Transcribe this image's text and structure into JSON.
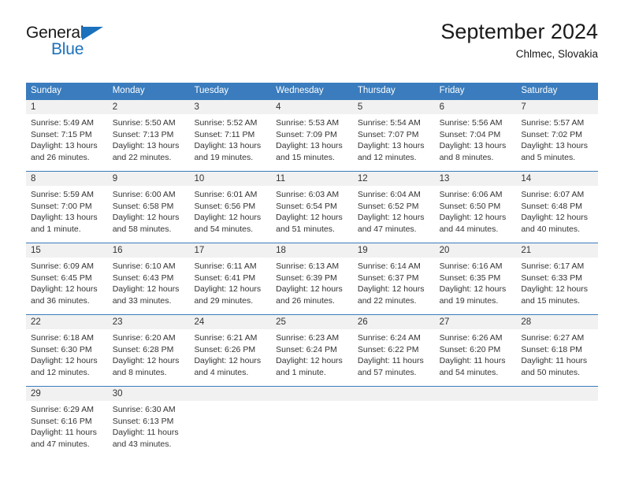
{
  "brand": {
    "name_top": "General",
    "name_bottom": "Blue",
    "triangle_color": "#1c71bd"
  },
  "header": {
    "title": "September 2024",
    "subtitle": "Chlmec, Slovakia"
  },
  "theme": {
    "header_blue": "#3a7cbd",
    "day_band_gray": "#f1f1f1",
    "text": "#333333"
  },
  "calendar": {
    "day_headers": [
      "Sunday",
      "Monday",
      "Tuesday",
      "Wednesday",
      "Thursday",
      "Friday",
      "Saturday"
    ],
    "weeks": [
      [
        {
          "date": "1",
          "sunrise": "Sunrise: 5:49 AM",
          "sunset": "Sunset: 7:15 PM",
          "daylight_line1": "Daylight: 13 hours",
          "daylight_line2": "and 26 minutes."
        },
        {
          "date": "2",
          "sunrise": "Sunrise: 5:50 AM",
          "sunset": "Sunset: 7:13 PM",
          "daylight_line1": "Daylight: 13 hours",
          "daylight_line2": "and 22 minutes."
        },
        {
          "date": "3",
          "sunrise": "Sunrise: 5:52 AM",
          "sunset": "Sunset: 7:11 PM",
          "daylight_line1": "Daylight: 13 hours",
          "daylight_line2": "and 19 minutes."
        },
        {
          "date": "4",
          "sunrise": "Sunrise: 5:53 AM",
          "sunset": "Sunset: 7:09 PM",
          "daylight_line1": "Daylight: 13 hours",
          "daylight_line2": "and 15 minutes."
        },
        {
          "date": "5",
          "sunrise": "Sunrise: 5:54 AM",
          "sunset": "Sunset: 7:07 PM",
          "daylight_line1": "Daylight: 13 hours",
          "daylight_line2": "and 12 minutes."
        },
        {
          "date": "6",
          "sunrise": "Sunrise: 5:56 AM",
          "sunset": "Sunset: 7:04 PM",
          "daylight_line1": "Daylight: 13 hours",
          "daylight_line2": "and 8 minutes."
        },
        {
          "date": "7",
          "sunrise": "Sunrise: 5:57 AM",
          "sunset": "Sunset: 7:02 PM",
          "daylight_line1": "Daylight: 13 hours",
          "daylight_line2": "and 5 minutes."
        }
      ],
      [
        {
          "date": "8",
          "sunrise": "Sunrise: 5:59 AM",
          "sunset": "Sunset: 7:00 PM",
          "daylight_line1": "Daylight: 13 hours",
          "daylight_line2": "and 1 minute."
        },
        {
          "date": "9",
          "sunrise": "Sunrise: 6:00 AM",
          "sunset": "Sunset: 6:58 PM",
          "daylight_line1": "Daylight: 12 hours",
          "daylight_line2": "and 58 minutes."
        },
        {
          "date": "10",
          "sunrise": "Sunrise: 6:01 AM",
          "sunset": "Sunset: 6:56 PM",
          "daylight_line1": "Daylight: 12 hours",
          "daylight_line2": "and 54 minutes."
        },
        {
          "date": "11",
          "sunrise": "Sunrise: 6:03 AM",
          "sunset": "Sunset: 6:54 PM",
          "daylight_line1": "Daylight: 12 hours",
          "daylight_line2": "and 51 minutes."
        },
        {
          "date": "12",
          "sunrise": "Sunrise: 6:04 AM",
          "sunset": "Sunset: 6:52 PM",
          "daylight_line1": "Daylight: 12 hours",
          "daylight_line2": "and 47 minutes."
        },
        {
          "date": "13",
          "sunrise": "Sunrise: 6:06 AM",
          "sunset": "Sunset: 6:50 PM",
          "daylight_line1": "Daylight: 12 hours",
          "daylight_line2": "and 44 minutes."
        },
        {
          "date": "14",
          "sunrise": "Sunrise: 6:07 AM",
          "sunset": "Sunset: 6:48 PM",
          "daylight_line1": "Daylight: 12 hours",
          "daylight_line2": "and 40 minutes."
        }
      ],
      [
        {
          "date": "15",
          "sunrise": "Sunrise: 6:09 AM",
          "sunset": "Sunset: 6:45 PM",
          "daylight_line1": "Daylight: 12 hours",
          "daylight_line2": "and 36 minutes."
        },
        {
          "date": "16",
          "sunrise": "Sunrise: 6:10 AM",
          "sunset": "Sunset: 6:43 PM",
          "daylight_line1": "Daylight: 12 hours",
          "daylight_line2": "and 33 minutes."
        },
        {
          "date": "17",
          "sunrise": "Sunrise: 6:11 AM",
          "sunset": "Sunset: 6:41 PM",
          "daylight_line1": "Daylight: 12 hours",
          "daylight_line2": "and 29 minutes."
        },
        {
          "date": "18",
          "sunrise": "Sunrise: 6:13 AM",
          "sunset": "Sunset: 6:39 PM",
          "daylight_line1": "Daylight: 12 hours",
          "daylight_line2": "and 26 minutes."
        },
        {
          "date": "19",
          "sunrise": "Sunrise: 6:14 AM",
          "sunset": "Sunset: 6:37 PM",
          "daylight_line1": "Daylight: 12 hours",
          "daylight_line2": "and 22 minutes."
        },
        {
          "date": "20",
          "sunrise": "Sunrise: 6:16 AM",
          "sunset": "Sunset: 6:35 PM",
          "daylight_line1": "Daylight: 12 hours",
          "daylight_line2": "and 19 minutes."
        },
        {
          "date": "21",
          "sunrise": "Sunrise: 6:17 AM",
          "sunset": "Sunset: 6:33 PM",
          "daylight_line1": "Daylight: 12 hours",
          "daylight_line2": "and 15 minutes."
        }
      ],
      [
        {
          "date": "22",
          "sunrise": "Sunrise: 6:18 AM",
          "sunset": "Sunset: 6:30 PM",
          "daylight_line1": "Daylight: 12 hours",
          "daylight_line2": "and 12 minutes."
        },
        {
          "date": "23",
          "sunrise": "Sunrise: 6:20 AM",
          "sunset": "Sunset: 6:28 PM",
          "daylight_line1": "Daylight: 12 hours",
          "daylight_line2": "and 8 minutes."
        },
        {
          "date": "24",
          "sunrise": "Sunrise: 6:21 AM",
          "sunset": "Sunset: 6:26 PM",
          "daylight_line1": "Daylight: 12 hours",
          "daylight_line2": "and 4 minutes."
        },
        {
          "date": "25",
          "sunrise": "Sunrise: 6:23 AM",
          "sunset": "Sunset: 6:24 PM",
          "daylight_line1": "Daylight: 12 hours",
          "daylight_line2": "and 1 minute."
        },
        {
          "date": "26",
          "sunrise": "Sunrise: 6:24 AM",
          "sunset": "Sunset: 6:22 PM",
          "daylight_line1": "Daylight: 11 hours",
          "daylight_line2": "and 57 minutes."
        },
        {
          "date": "27",
          "sunrise": "Sunrise: 6:26 AM",
          "sunset": "Sunset: 6:20 PM",
          "daylight_line1": "Daylight: 11 hours",
          "daylight_line2": "and 54 minutes."
        },
        {
          "date": "28",
          "sunrise": "Sunrise: 6:27 AM",
          "sunset": "Sunset: 6:18 PM",
          "daylight_line1": "Daylight: 11 hours",
          "daylight_line2": "and 50 minutes."
        }
      ],
      [
        {
          "date": "29",
          "sunrise": "Sunrise: 6:29 AM",
          "sunset": "Sunset: 6:16 PM",
          "daylight_line1": "Daylight: 11 hours",
          "daylight_line2": "and 47 minutes."
        },
        {
          "date": "30",
          "sunrise": "Sunrise: 6:30 AM",
          "sunset": "Sunset: 6:13 PM",
          "daylight_line1": "Daylight: 11 hours",
          "daylight_line2": "and 43 minutes."
        },
        {
          "date": "",
          "sunrise": "",
          "sunset": "",
          "daylight_line1": "",
          "daylight_line2": ""
        },
        {
          "date": "",
          "sunrise": "",
          "sunset": "",
          "daylight_line1": "",
          "daylight_line2": ""
        },
        {
          "date": "",
          "sunrise": "",
          "sunset": "",
          "daylight_line1": "",
          "daylight_line2": ""
        },
        {
          "date": "",
          "sunrise": "",
          "sunset": "",
          "daylight_line1": "",
          "daylight_line2": ""
        },
        {
          "date": "",
          "sunrise": "",
          "sunset": "",
          "daylight_line1": "",
          "daylight_line2": ""
        }
      ]
    ]
  }
}
